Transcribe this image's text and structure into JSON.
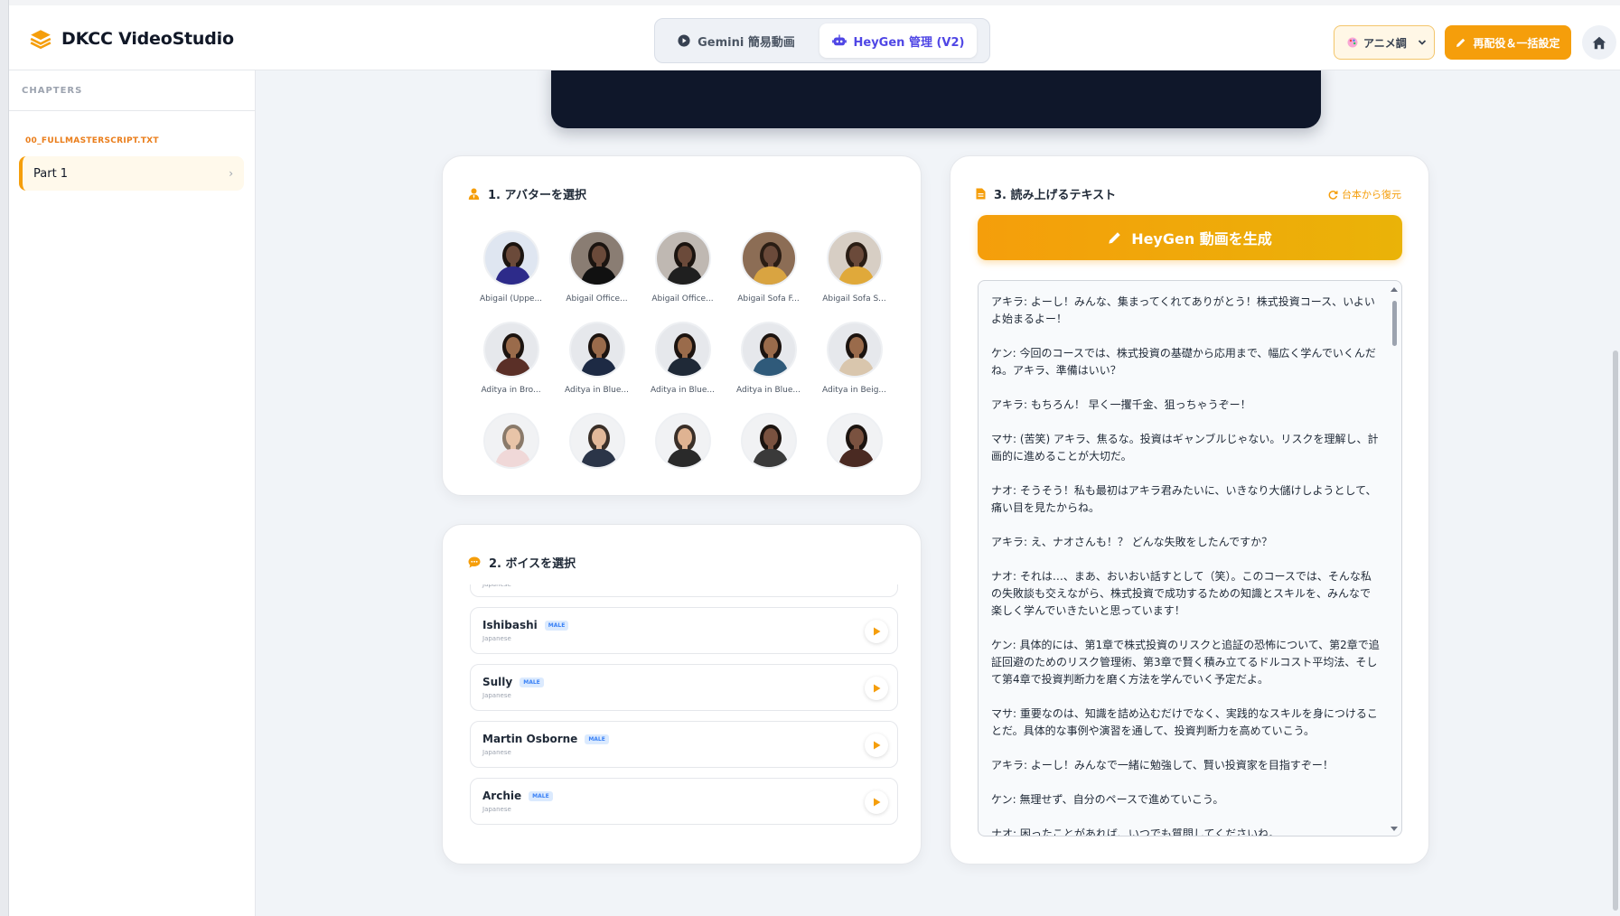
{
  "header": {
    "app_title": "DKCC VideoStudio",
    "mode_tabs": [
      {
        "label": "Gemini 簡易動画",
        "active": false
      },
      {
        "label": "HeyGen 管理 (V2)",
        "active": true
      }
    ],
    "style_select": {
      "value": "アニメ調"
    },
    "recast_button": "再配役＆一括設定"
  },
  "sidebar": {
    "heading": "CHAPTERS",
    "file_name": "00_FULLMASTERSCRIPT.TXT",
    "parts": [
      {
        "label": "Part 1",
        "active": true
      }
    ]
  },
  "avatar_section": {
    "title": "1. アバターを選択",
    "avatars": [
      {
        "name": "Abigail (Uppe...",
        "skin": "#6b4a3a",
        "hair": "#1b1410",
        "outfit": "#2d2b8a",
        "bg": "#dfe6f1"
      },
      {
        "name": "Abigail Office...",
        "skin": "#6b4a3a",
        "hair": "#1b1410",
        "outfit": "#111111",
        "bg": "#8a7d73"
      },
      {
        "name": "Abigail Office...",
        "skin": "#6b4a3a",
        "hair": "#1b1410",
        "outfit": "#1f1f1f",
        "bg": "#bfb8b2"
      },
      {
        "name": "Abigail Sofa F...",
        "skin": "#6b4a3a",
        "hair": "#2a1d14",
        "outfit": "#d9a441",
        "bg": "#8c6d55"
      },
      {
        "name": "Abigail Sofa S...",
        "skin": "#6b4a3a",
        "hair": "#2a1d14",
        "outfit": "#e0a93a",
        "bg": "#d7cec4"
      },
      {
        "name": "Aditya in Bro...",
        "skin": "#9a6b4b",
        "hair": "#1c1410",
        "outfit": "#5a2f27",
        "bg": "#e6e8ec"
      },
      {
        "name": "Aditya in Blue...",
        "skin": "#9a6b4b",
        "hair": "#1c1410",
        "outfit": "#1d2a44",
        "bg": "#e6e8ec"
      },
      {
        "name": "Aditya in Blue...",
        "skin": "#9a6b4b",
        "hair": "#1c1410",
        "outfit": "#1f2937",
        "bg": "#e6e8ec"
      },
      {
        "name": "Aditya in Blue...",
        "skin": "#9a6b4b",
        "hair": "#1c1410",
        "outfit": "#2f5a7a",
        "bg": "#e6e8ec"
      },
      {
        "name": "Aditya in Beig...",
        "skin": "#9a6b4b",
        "hair": "#1c1410",
        "outfit": "#d9c6ad",
        "bg": "#e6e8ec"
      },
      {
        "name": "",
        "skin": "#e8c4a8",
        "hair": "#8a7a6a",
        "outfit": "#f0d8d8",
        "bg": "#f1f2f4"
      },
      {
        "name": "",
        "skin": "#e2b899",
        "hair": "#3a2f28",
        "outfit": "#2b3548",
        "bg": "#f1f2f4"
      },
      {
        "name": "",
        "skin": "#dfb392",
        "hair": "#3a2f28",
        "outfit": "#2a2a2a",
        "bg": "#f1f2f4"
      },
      {
        "name": "",
        "skin": "#7a5240",
        "hair": "#1c1410",
        "outfit": "#3a3a3a",
        "bg": "#f1f2f4"
      },
      {
        "name": "",
        "skin": "#7a5240",
        "hair": "#1c1410",
        "outfit": "#4a2a22",
        "bg": "#f1f2f4"
      }
    ]
  },
  "voice_section": {
    "title": "2. ボイスを選択",
    "voices": [
      {
        "name": "",
        "badge": "",
        "lang": "Japanese",
        "partial": true
      },
      {
        "name": "Ishibashi",
        "badge": "MALE",
        "lang": "Japanese",
        "partial": false
      },
      {
        "name": "Sully",
        "badge": "MALE",
        "lang": "Japanese",
        "partial": false
      },
      {
        "name": "Martin Osborne",
        "badge": "MALE",
        "lang": "Japanese",
        "partial": false
      },
      {
        "name": "Archie",
        "badge": "MALE",
        "lang": "Japanese",
        "partial": false
      }
    ]
  },
  "script_section": {
    "title": "3. 読み上げるテキスト",
    "restore_link": "台本から復元",
    "generate_button": "HeyGen 動画を生成",
    "paragraphs": [
      "アキラ: よーし！みんな、集まってくれてありがとう！株式投資コース、いよいよ始まるよー！",
      "ケン: 今回のコースでは、株式投資の基礎から応用まで、幅広く学んでいくんだね。アキラ、準備はいい？",
      "アキラ: もちろん！ 早く一攫千金、狙っちゃうぞー！",
      "マサ: (苦笑) アキラ、焦るな。投資はギャンブルじゃない。リスクを理解し、計画的に進めることが大切だ。",
      "ナオ: そうそう！私も最初はアキラ君みたいに、いきなり大儲けしようとして、痛い目を見たからね。",
      "アキラ: え、ナオさんも！？ どんな失敗をしたんですか？",
      "ナオ: それは…、まあ、おいおい話すとして（笑）。このコースでは、そんな私の失敗談も交えながら、株式投資で成功するための知識とスキルを、みんなで楽しく学んでいきたいと思っています！",
      "ケン: 具体的には、第1章で株式投資のリスクと追証の恐怖について、第2章で追証回避のためのリスク管理術、第3章で賢く積み立てるドルコスト平均法、そして第4章で投資判断力を磨く方法を学んでいく予定だよ。",
      "マサ: 重要なのは、知識を詰め込むだけでなく、実践的なスキルを身につけることだ。具体的な事例や演習を通して、投資判断力を高めていこう。",
      "アキラ: よーし！みんなで一緒に勉強して、賢い投資家を目指すぞー！",
      "ケン: 無理せず、自分のペースで進めていこう。",
      "ナオ: 困ったことがあれば、いつでも質問してくださいね。"
    ]
  },
  "colors": {
    "accent": "#f59e0b",
    "indigo": "#4f46e5",
    "video_bg": "#0f172a"
  }
}
